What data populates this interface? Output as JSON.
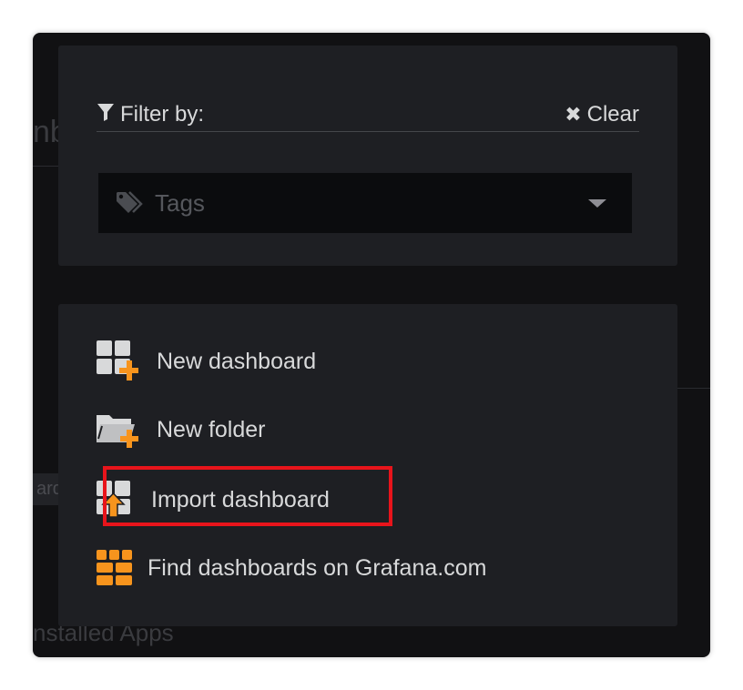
{
  "background": {
    "partial_title": "nb",
    "partial_badge": "ard",
    "partial_section": "nstalled Apps"
  },
  "filter": {
    "label": "Filter by:",
    "clear_label": "Clear",
    "tags_placeholder": "Tags"
  },
  "actions": {
    "new_dashboard": "New dashboard",
    "new_folder": "New folder",
    "import_dashboard": "Import dashboard",
    "find_dashboards": "Find dashboards on Grafana.com"
  },
  "colors": {
    "accent": "#f7941d",
    "highlight": "#e8141b",
    "panel": "#1e1f23",
    "text": "#d8d9da"
  },
  "icons": {
    "filter": "filter-icon",
    "clear": "close-icon",
    "tags": "tag-icon",
    "new_dashboard": "dashboard-add-icon",
    "new_folder": "folder-add-icon",
    "import_dashboard": "dashboard-import-icon",
    "find_dashboards": "grafana-grid-icon"
  }
}
